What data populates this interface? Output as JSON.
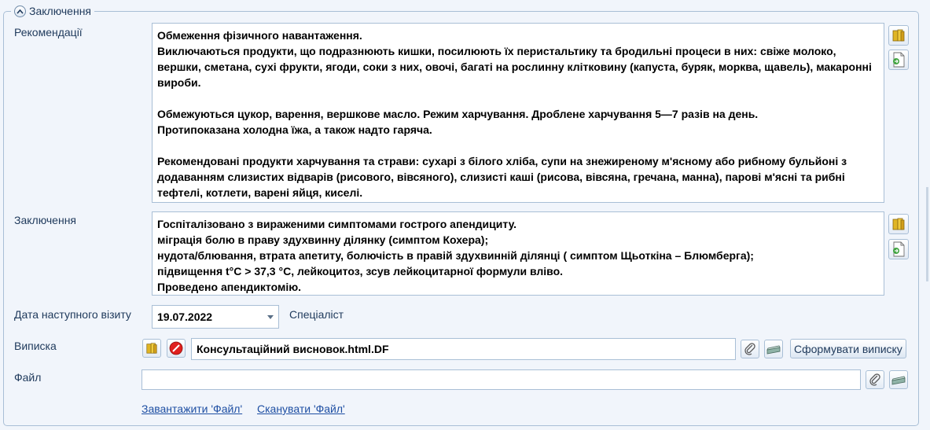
{
  "group": {
    "title": "Заключення"
  },
  "recommendations": {
    "label": "Рекомендації",
    "text": "Обмеження фізичного навантаження.\nВиключаються продукти, що подразнюють кишки, посилюють їх перистальтику та бродильні процеси в них: свіже молоко, вершки, сметана, сухі фрукти, ягоди, соки з них, овочі, багаті на рослинну клітковину (капуста, буряк, морква, щавель), макаронні вироби.\n\nОбмежуються цукор, варення, вершкове масло. Режим харчування. Дроблене харчування 5—7 разів на день.\nПротипоказана холодна їжа, а також надто гаряча.\n\nРекомендовані продукти харчування та страви: сухарі з білого хліба, супи на знежиреному м'ясному або рибному бульйоні з додаванням слизистих відварів (рисового, вівсяного), слизисті каші (рисова, вівсяна, гречана, манна), парові м'ясні та рибні тефтелі, котлети, варені яйця, киселі."
  },
  "conclusion": {
    "label": "Заключення",
    "text": "Госпіталізовано з вираженими симптомами гострого апендициту.\nміграція болю в праву здухвинну ділянку (симптом Кохера);\nнудота/блювання, втрата апетиту, болючість в правій здухвинній ділянці ( симптом Щьоткіна – Блюмберга);\nпідвищення t°С > 37,3 °С, лейкоцитоз, зсув лейкоцитарної формули вліво.\nПроведено апендиктомію."
  },
  "next_visit": {
    "label": "Дата наступного візиту",
    "value": "19.07.2022",
    "specialist_label": "Спеціаліст"
  },
  "extract": {
    "label": "Виписка",
    "file_name": "Консультаційний висновок.html.DF",
    "generate_button": "Сформувати виписку"
  },
  "file": {
    "label": "Файл",
    "value": ""
  },
  "links": {
    "upload": "Завантажити 'Файл'",
    "scan": "Сканувати 'Файл'"
  },
  "icons": {
    "collapse": "chevron-up-icon",
    "template": "book-icon",
    "insert": "insert-document-icon",
    "clear": "clear-red-icon",
    "attach": "paperclip-icon",
    "scan": "scanner-icon"
  }
}
